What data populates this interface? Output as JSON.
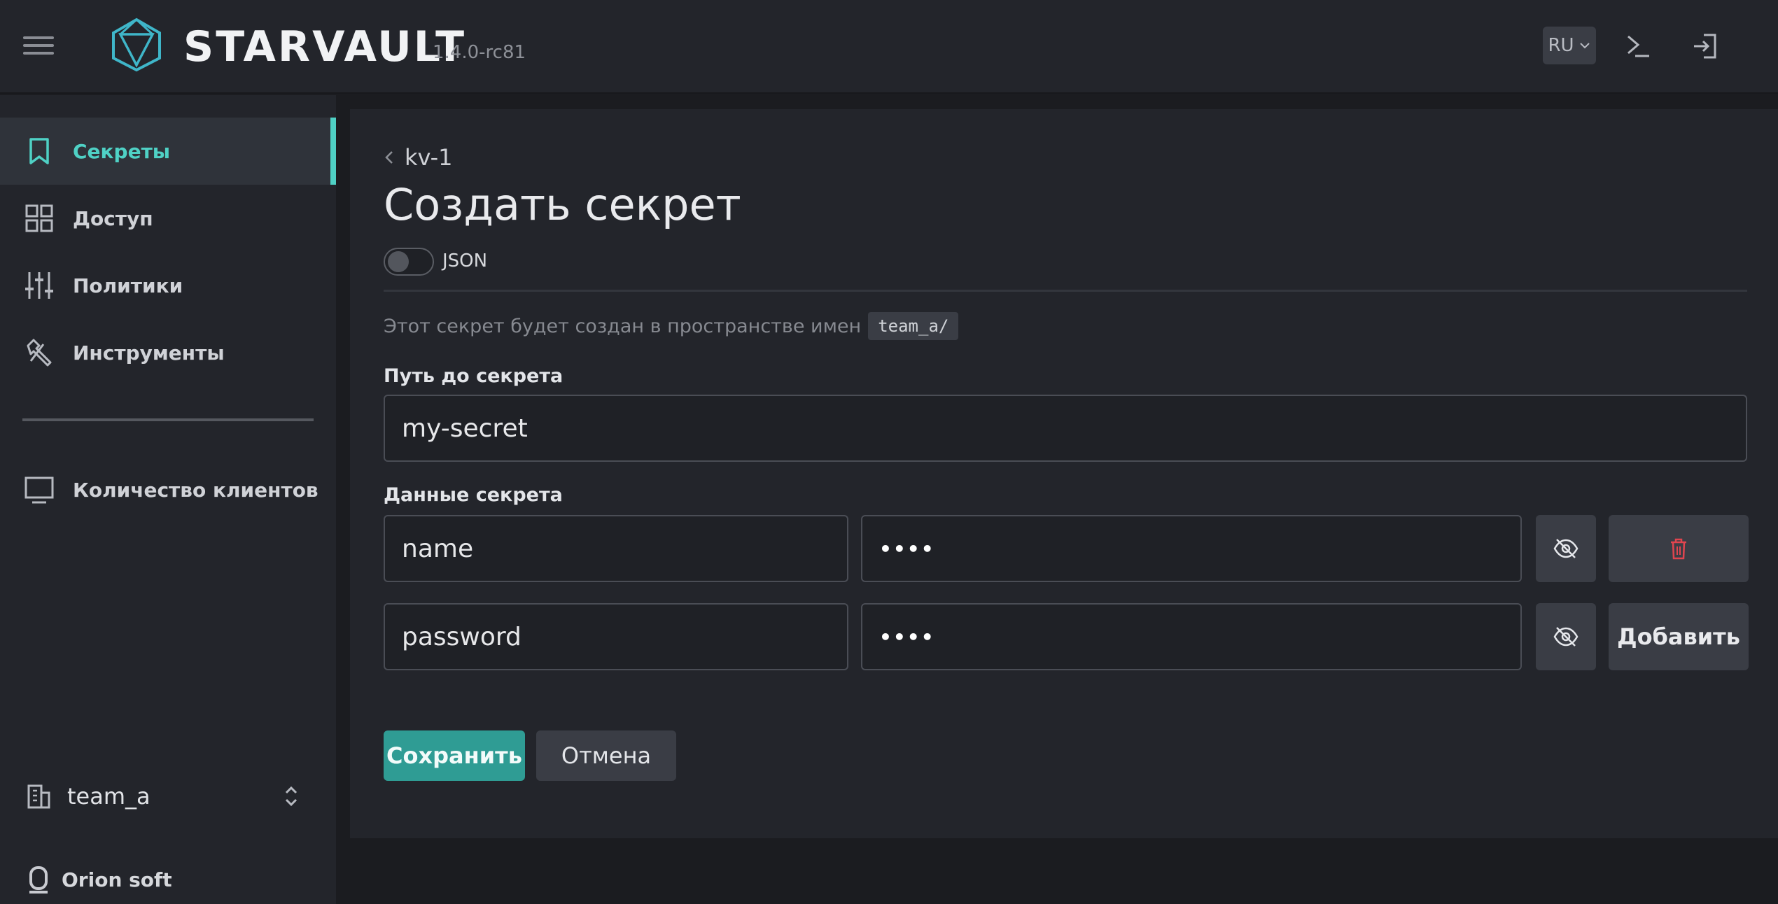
{
  "header": {
    "brand": "STARVAULT",
    "version": "1.4.0-rc81",
    "language": "RU",
    "icons": [
      "menu-icon",
      "logo-icon",
      "chevron-down-icon",
      "terminal-icon",
      "logout-icon"
    ]
  },
  "sidebar": {
    "items": [
      {
        "label": "Секреты",
        "icon": "bookmark-icon",
        "active": true
      },
      {
        "label": "Доступ",
        "icon": "grid-icon",
        "active": false
      },
      {
        "label": "Политики",
        "icon": "sliders-icon",
        "active": false
      },
      {
        "label": "Инструменты",
        "icon": "tools-icon",
        "active": false
      },
      {
        "label": "Количество клиентов",
        "icon": "monitor-icon",
        "active": false
      }
    ],
    "namespace": "team_a",
    "company": "Orion soft"
  },
  "main": {
    "breadcrumb": "kv-1",
    "title": "Создать секрет",
    "json_toggle_label": "JSON",
    "json_toggle_on": false,
    "namespace_note": "Этот секрет будет создан в пространстве имен",
    "namespace_tag": "team_a/",
    "path_label": "Путь до секрета",
    "path_value": "my-secret",
    "data_label": "Данные секрета",
    "rows": [
      {
        "key": "name",
        "value": "••••",
        "action": "delete-icon"
      },
      {
        "key": "password",
        "value": "••••",
        "action": "Добавить"
      }
    ],
    "save_label": "Сохранить",
    "cancel_label": "Отмена"
  },
  "colors": {
    "accent": "#4fd1c5",
    "save_button": "#2f9c94",
    "delete_icon": "#e0454f",
    "panel": "#23252b",
    "background": "#1b1c20"
  }
}
